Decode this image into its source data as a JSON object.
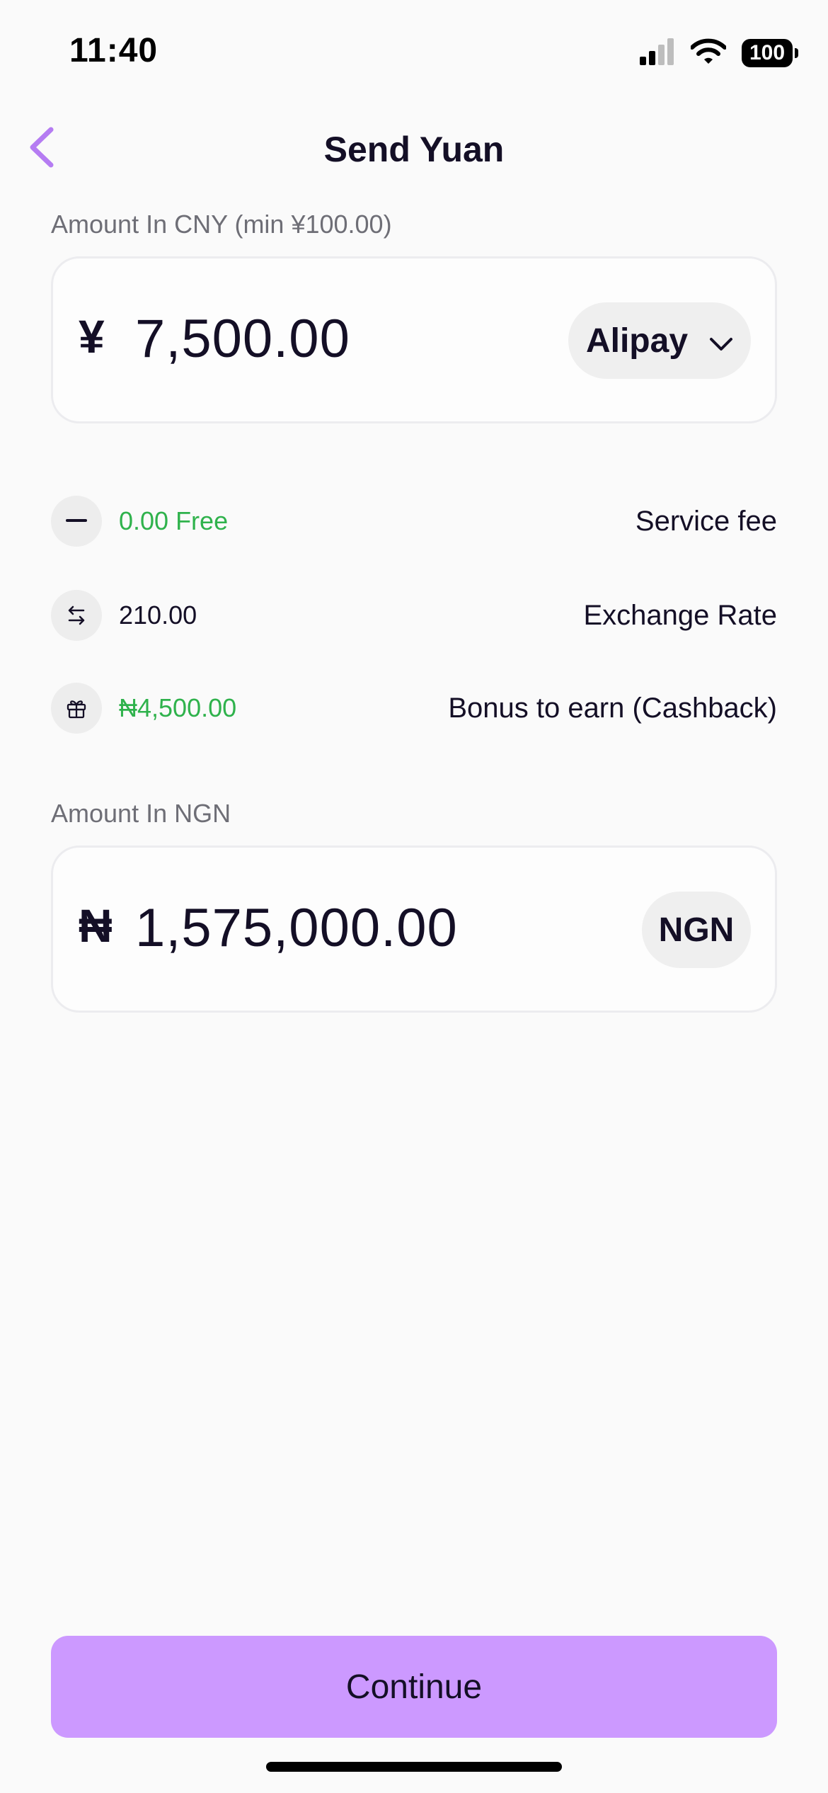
{
  "status_bar": {
    "time": "11:40",
    "battery": "100",
    "icons": [
      "signal-icon",
      "wifi-icon",
      "battery-icon"
    ]
  },
  "header": {
    "title": "Send Yuan",
    "back_icon": "chevron-left-icon"
  },
  "cny_field": {
    "label": "Amount In CNY (min ¥100.00)",
    "symbol": "¥",
    "amount": "7,500.00",
    "method": "Alipay",
    "method_icon": "chevron-down-icon"
  },
  "details": [
    {
      "icon": "minus-icon",
      "value": "0.00 Free",
      "label": "Service fee",
      "value_color": "#2fb24c"
    },
    {
      "icon": "exchange-icon",
      "value": "210.00",
      "label": "Exchange Rate",
      "value_color": "#140f26"
    },
    {
      "icon": "gift-icon",
      "value": "₦4,500.00",
      "label": "Bonus to earn (Cashback)",
      "value_color": "#2fb24c"
    }
  ],
  "ngn_field": {
    "label": "Amount In NGN",
    "symbol": "₦",
    "amount": "1,575,000.00",
    "currency": "NGN"
  },
  "continue_label": "Continue",
  "colors": {
    "accent": "#cc99ff",
    "back_arrow": "#b57cf2",
    "success": "#2fb24c",
    "text": "#140f26",
    "background": "#fafafa"
  }
}
